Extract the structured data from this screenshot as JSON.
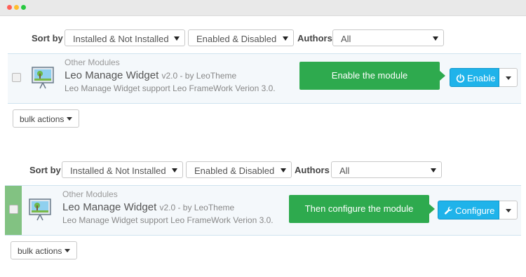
{
  "window": {
    "controls": [
      "close",
      "minimize",
      "maximize"
    ]
  },
  "colors": {
    "callout_green": "#2eaa4e",
    "primary_blue": "#1fb3ea",
    "row_highlight_green": "#82c282",
    "row_background": "#f4f8fb"
  },
  "sections": [
    {
      "filters": {
        "sort_label": "Sort by",
        "install_filter": "Installed & Not Installed",
        "status_filter": "Enabled & Disabled",
        "authors_label": "Authors",
        "authors_filter": "All"
      },
      "module": {
        "category": "Other Modules",
        "name": "Leo Manage Widget",
        "meta": "v2.0 - by LeoTheme",
        "description": "Leo Manage Widget support Leo FrameWork Verion 3.0.",
        "icon": "module-icon"
      },
      "callout": "Enable the module",
      "action": {
        "label": "Enable",
        "icon": "power-icon"
      },
      "bulk_actions": "bulk actions"
    },
    {
      "filters": {
        "sort_label": "Sort by",
        "install_filter": "Installed & Not Installed",
        "status_filter": "Enabled & Disabled",
        "authors_label": "Authors",
        "authors_filter": "All"
      },
      "module": {
        "category": "Other Modules",
        "name": "Leo Manage Widget",
        "meta": "v2.0 - by LeoTheme",
        "description": "Leo Manage Widget support Leo FrameWork Verion 3.0.",
        "icon": "module-icon"
      },
      "callout": "Then configure the module",
      "action": {
        "label": "Configure",
        "icon": "wrench-icon"
      },
      "bulk_actions": "bulk actions"
    }
  ]
}
